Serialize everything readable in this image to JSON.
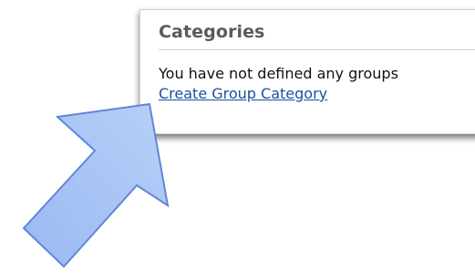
{
  "categories_panel": {
    "title": "Categories",
    "message": "You have not defined any groups",
    "create_link_label": "Create Group Category"
  },
  "colors": {
    "arrow_fill": "#a9c4f5",
    "arrow_stroke": "#5f87d6",
    "link": "#1b4fa0",
    "title": "#5a5a5a"
  },
  "annotation": {
    "arrow_icon": "pointer-arrow-icon"
  }
}
